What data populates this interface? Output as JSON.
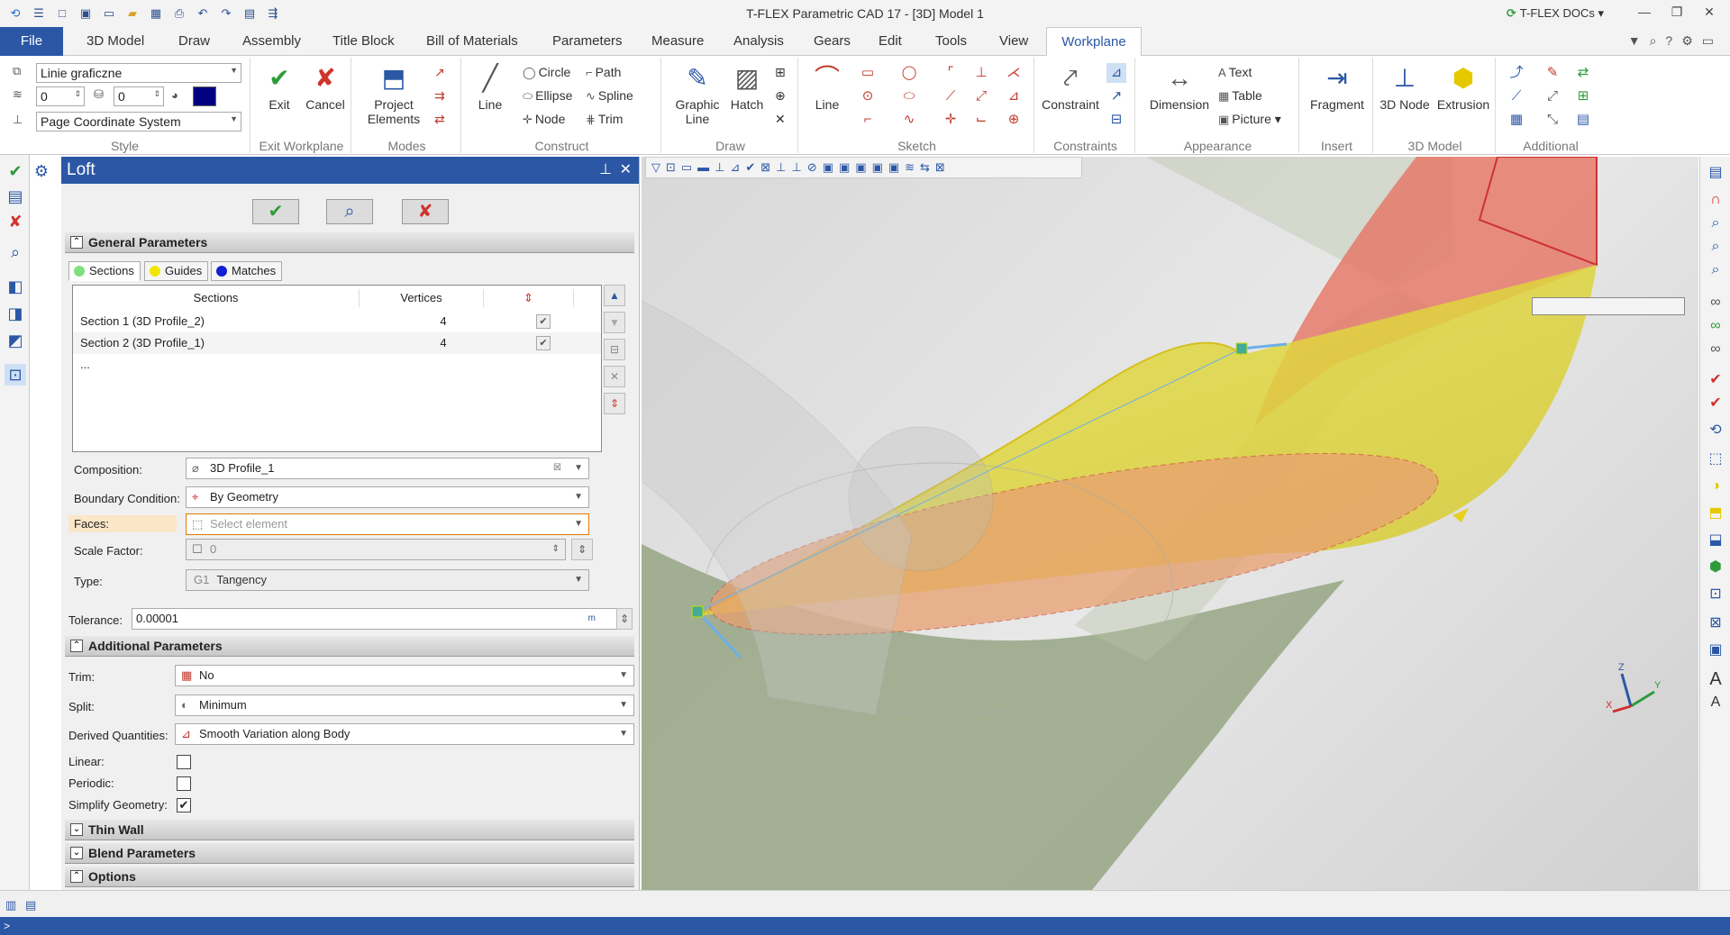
{
  "title_bar": {
    "app_title": "T-FLEX Parametric CAD 17 - [3D] Model 1",
    "docs_label": "T-FLEX DOCs",
    "quick_access": [
      "menu-icon",
      "new-doc-icon",
      "windows-icon",
      "window-icon",
      "open-icon",
      "save-icon",
      "print-icon",
      "undo-icon",
      "redo-icon",
      "page-icon",
      "command-icon"
    ]
  },
  "ribbon_tabs": {
    "file": "File",
    "items": [
      "3D Model",
      "Draw",
      "Assembly",
      "Title Block",
      "Bill of Materials",
      "Parameters",
      "Measure",
      "Analysis",
      "Gears",
      "Edit",
      "Tools",
      "View",
      "Workplane"
    ],
    "active": "Workplane"
  },
  "ribbon": {
    "style": {
      "label": "Style",
      "line_style": "Linie graficzne",
      "layer_value": "0",
      "level_value": "0",
      "color_hex": "#000080",
      "coord_system": "Page Coordinate System"
    },
    "exit_workplane": {
      "label": "Exit Workplane",
      "exit": "Exit",
      "cancel": "Cancel"
    },
    "modes": {
      "label": "Modes",
      "project_elements": "Project Elements"
    },
    "construct": {
      "label": "Construct",
      "line": "Line",
      "circle": "Circle",
      "ellipse": "Ellipse",
      "node": "Node",
      "path": "Path",
      "spline": "Spline",
      "trim": "Trim"
    },
    "draw": {
      "label": "Draw",
      "graphic_line": "Graphic Line",
      "hatch": "Hatch"
    },
    "sketch": {
      "label": "Sketch",
      "line": "Line"
    },
    "constraints": {
      "label": "Constraints",
      "constraint": "Constraint"
    },
    "appearance": {
      "label": "Appearance",
      "dimension": "Dimension",
      "text": "Text",
      "table": "Table",
      "picture": "Picture"
    },
    "insert": {
      "label": "Insert",
      "fragment": "Fragment"
    },
    "model_3d": {
      "label": "3D Model",
      "node_3d": "3D Node",
      "extrusion": "Extrusion"
    },
    "additional": {
      "label": "Additional"
    }
  },
  "panel": {
    "title": "Loft",
    "sections_general": "General Parameters",
    "tabs": [
      {
        "label": "Sections",
        "color": "#7ee07e"
      },
      {
        "label": "Guides",
        "color": "#f2e600"
      },
      {
        "label": "Matches",
        "color": "#1020d0"
      }
    ],
    "table": {
      "headers": [
        "Sections",
        "Vertices"
      ],
      "rows": [
        {
          "name": "Section 1 (3D Profile_2)",
          "vertices": "4",
          "checked": true
        },
        {
          "name": "Section 2 (3D Profile_1)",
          "vertices": "4",
          "checked": true
        },
        {
          "name": "...",
          "vertices": "",
          "checked": false
        }
      ]
    },
    "composition_label": "Composition:",
    "composition_value": "3D Profile_1",
    "boundary_label": "Boundary Condition:",
    "boundary_value": "By Geometry",
    "faces_label": "Faces:",
    "faces_placeholder": "Select element",
    "scale_label": "Scale Factor:",
    "scale_value": "0",
    "type_label": "Type:",
    "type_prefix": "G1",
    "type_value": "Tangency",
    "tolerance_label": "Tolerance:",
    "tolerance_value": "0.00001",
    "tolerance_unit": "m",
    "additional": "Additional Parameters",
    "trim_label": "Trim:",
    "trim_value": "No",
    "split_label": "Split:",
    "split_value": "Minimum",
    "derived_label": "Derived Quantities:",
    "derived_value": "Smooth Variation along Body",
    "linear_label": "Linear:",
    "periodic_label": "Periodic:",
    "simplify_label": "Simplify Geometry:",
    "linear_checked": false,
    "periodic_checked": false,
    "simplify_checked": true,
    "thin_wall": "Thin Wall",
    "blend": "Blend Parameters",
    "options": "Options"
  },
  "viewport": {
    "axis_labels": {
      "x": "X",
      "y": "Y",
      "z": "Z"
    },
    "colors": {
      "loft_yellow": "#e8e04a",
      "face_red": "#e57a6a",
      "body_green": "#9aa98a",
      "section_orange": "#e8a070"
    }
  },
  "status": {
    "prompt": ">"
  }
}
